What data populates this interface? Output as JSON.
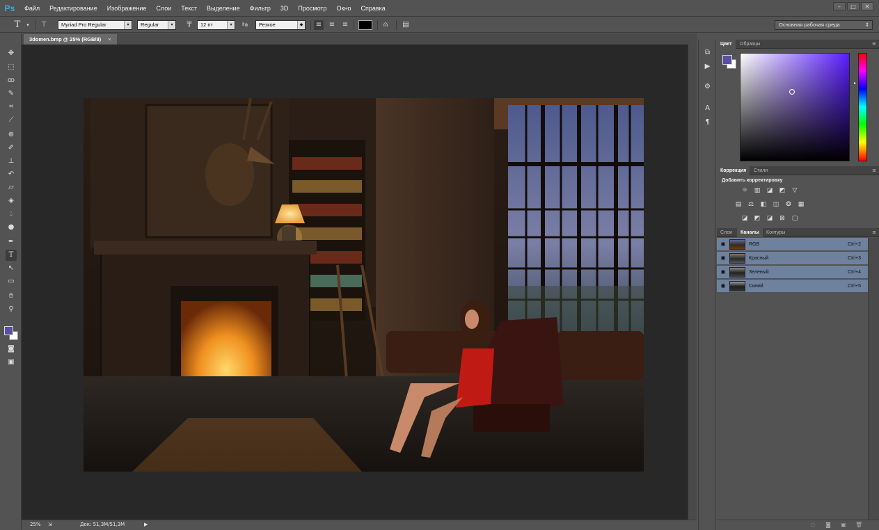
{
  "app": {
    "logo": "Ps"
  },
  "menu": [
    "Файл",
    "Редактирование",
    "Изображение",
    "Слои",
    "Текст",
    "Выделение",
    "Фильтр",
    "3D",
    "Просмотр",
    "Окно",
    "Справка"
  ],
  "window_controls": {
    "minimize": "–",
    "maximize": "□",
    "close": "✕"
  },
  "options": {
    "font_family": "Myriad Pro Regular",
    "font_style": "Regular",
    "font_size": "12 пт",
    "antialias": "Резкое",
    "text_color": "#000000"
  },
  "workspace": "Основная рабочая среда",
  "document": {
    "tab_title": "3domen.bmp @ 25% (RGB/8)",
    "tab_close": "×"
  },
  "status": {
    "zoom": "25%",
    "doc_info": "Док: 51,3M/51,3M"
  },
  "panels": {
    "color": {
      "tabs": [
        "Цвет",
        "Образцы"
      ],
      "foreground": "#5a4fa0",
      "background": "#ffffff"
    },
    "adjustments": {
      "tabs": [
        "Коррекция",
        "Стили"
      ],
      "heading": "Добавить корректировку"
    },
    "layers": {
      "tabs": [
        "Слои",
        "Каналы",
        "Контуры"
      ],
      "channels": [
        {
          "name": "RGB",
          "shortcut": "Ctrl+2"
        },
        {
          "name": "Красный",
          "shortcut": "Ctrl+3"
        },
        {
          "name": "Зеленый",
          "shortcut": "Ctrl+4"
        },
        {
          "name": "Синий",
          "shortcut": "Ctrl+5"
        }
      ]
    }
  }
}
